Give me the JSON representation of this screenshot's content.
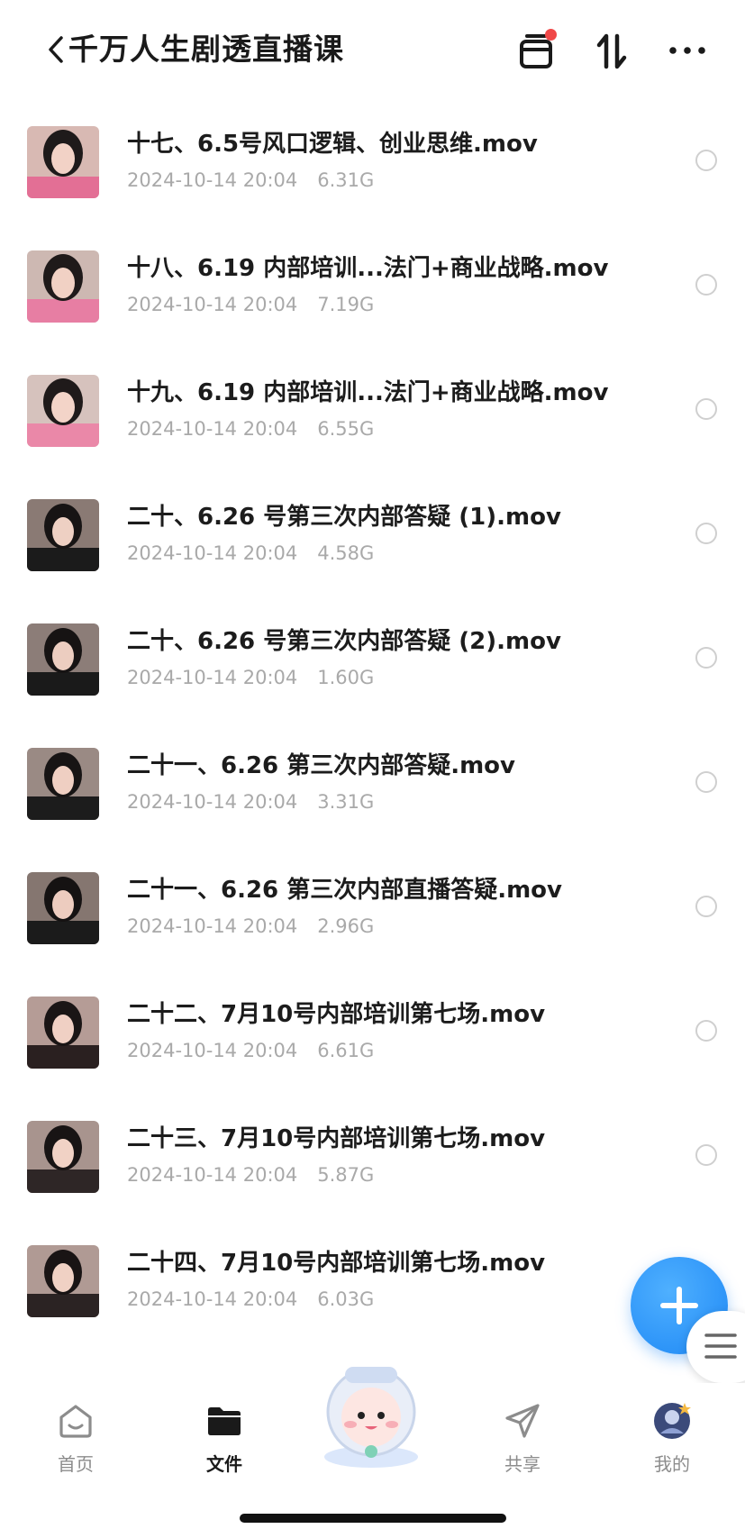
{
  "header": {
    "title": "千万人生剧透直播课",
    "back_icon": "chevron-left-icon",
    "actions": [
      {
        "name": "transfer-list-icon",
        "has_badge": true
      },
      {
        "name": "sort-icon"
      },
      {
        "name": "more-icon"
      }
    ],
    "badge_color": "#f04848"
  },
  "files": [
    {
      "name": "十七、6.5号风口逻辑、创业思维.mov",
      "date": "2024-10-14 20:04",
      "size": "6.31G"
    },
    {
      "name": "十八、6.19 内部培训...法门+商业战略.mov",
      "date": "2024-10-14 20:04",
      "size": "7.19G"
    },
    {
      "name": "十九、6.19 内部培训...法门+商业战略.mov",
      "date": "2024-10-14 20:04",
      "size": "6.55G"
    },
    {
      "name": "二十、6.26 号第三次内部答疑 (1).mov",
      "date": "2024-10-14 20:04",
      "size": "4.58G"
    },
    {
      "name": "二十、6.26 号第三次内部答疑 (2).mov",
      "date": "2024-10-14 20:04",
      "size": "1.60G"
    },
    {
      "name": "二十一、6.26 第三次内部答疑.mov",
      "date": "2024-10-14 20:04",
      "size": "3.31G"
    },
    {
      "name": "二十一、6.26 第三次内部直播答疑.mov",
      "date": "2024-10-14 20:04",
      "size": "2.96G"
    },
    {
      "name": "二十二、7月10号内部培训第七场.mov",
      "date": "2024-10-14 20:04",
      "size": "6.61G"
    },
    {
      "name": "二十三、7月10号内部培训第七场.mov",
      "date": "2024-10-14 20:04",
      "size": "5.87G"
    },
    {
      "name": "二十四、7月10号内部培训第七场.mov",
      "date": "2024-10-14 20:04",
      "size": "6.03G"
    }
  ],
  "fab": {
    "icon": "plus-icon",
    "color": "#1e88f5"
  },
  "tabbar": {
    "tabs": [
      {
        "label": "首页",
        "icon": "home-icon",
        "active": false
      },
      {
        "label": "文件",
        "icon": "folder-icon",
        "active": true
      },
      {
        "label": "共享",
        "icon": "send-icon",
        "active": false
      },
      {
        "label": "我的",
        "icon": "avatar-icon",
        "active": false
      }
    ]
  },
  "colors": {
    "text": "#1c1c1c",
    "meta": "#a9a9a9",
    "accent": "#1e88f5"
  }
}
